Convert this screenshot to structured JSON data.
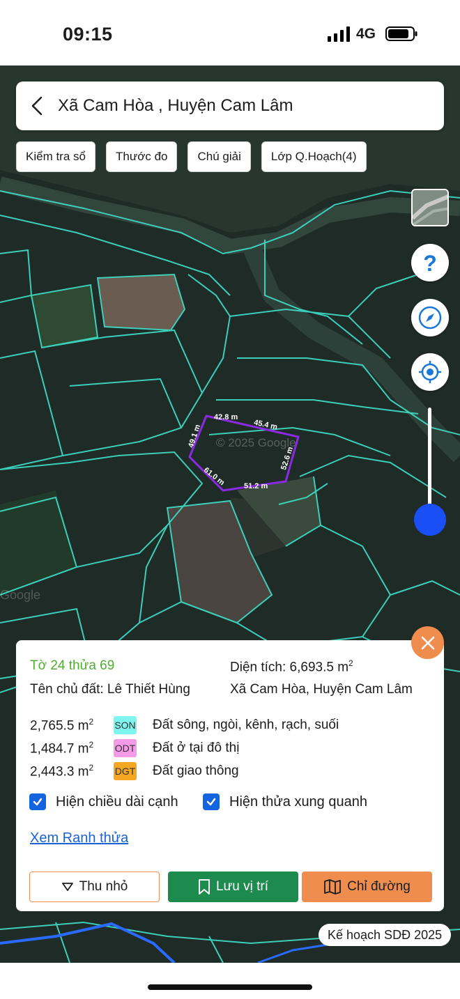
{
  "status_bar": {
    "time": "09:15",
    "network": "4G"
  },
  "header": {
    "title": "Xã Cam Hòa , Huyện Cam Lâm"
  },
  "chips": [
    "Kiểm tra sổ",
    "Thước đo",
    "Chú giải",
    "Lớp Q.Hoạch(4)"
  ],
  "map": {
    "edge_labels": [
      "42.8 m",
      "45.4 m",
      "49.1 m",
      "52.6 m",
      "61.0 m",
      "51.2 m"
    ],
    "watermark": "© 2025 Google",
    "google_label": "Google"
  },
  "side_controls": {
    "help_icon": "question-icon",
    "compass_icon": "compass-icon",
    "locate_icon": "locate-icon",
    "zoom_level": 0.15
  },
  "info": {
    "parcel_id": "Tờ 24 thửa 69",
    "area_prefix": "Diện tích: 6,693.5 m",
    "area_sup": "2",
    "owner": "Tên chủ đất: Lê Thiết Hùng",
    "location": "Xã Cam Hòa, Huyện Cam Lâm",
    "usage": [
      {
        "area": "2,765.5 m",
        "sup": "2",
        "code": "SON",
        "color": "#7ff5f0",
        "desc": "Đất sông, ngòi, kênh, rạch, suối"
      },
      {
        "area": "1,484.7 m",
        "sup": "2",
        "code": "ODT",
        "color": "#f59ae6",
        "desc": "Đất ở tại đô thị"
      },
      {
        "area": "2,443.3 m",
        "sup": "2",
        "code": "DGT",
        "color": "#f5a623",
        "desc": "Đất giao thông"
      }
    ],
    "checkbox_edges": "Hiện chiều dài cạnh",
    "checkbox_neighbors": "Hiện thửa xung quanh",
    "link_boundary": "Xem Ranh thửa",
    "btn_minimize": "Thu nhỏ",
    "btn_save": "Lưu vị trí",
    "btn_route": "Chỉ đường"
  },
  "plan_label": "Kế hoạch SDĐ 2025"
}
